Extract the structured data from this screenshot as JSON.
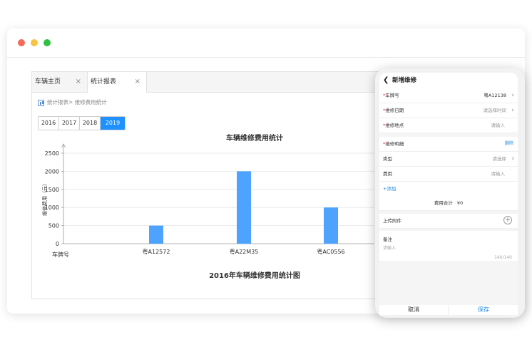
{
  "tabs": [
    {
      "label": "车辆主页",
      "close": "×"
    },
    {
      "label": "统计报表",
      "close": "×"
    }
  ],
  "breadcrumb": {
    "parent": "统计报表>",
    "current": "维修费用统计"
  },
  "year_buttons": [
    "2016",
    "2017",
    "2018",
    "2019"
  ],
  "active_year": "2019",
  "chart_data": {
    "type": "bar",
    "title": "车辆维修费用统计",
    "subtitle": "2016年车辆维修费用统计图",
    "xlabel": "车牌号",
    "ylabel": "维修费用（元）",
    "categories": [
      "粤A12572",
      "粤A22M35",
      "粤AC0556"
    ],
    "values": [
      500,
      2000,
      1000
    ],
    "ylim": [
      0,
      2500
    ],
    "yticks": [
      0,
      500,
      1000,
      1500,
      2000,
      2500
    ],
    "color": "#4da3ff",
    "grid": true
  },
  "mobile": {
    "title": "新增维修",
    "plate_label": "车牌号",
    "plate_value": "粤A12138",
    "date_label": "维修日期",
    "date_placeholder": "请选择时间",
    "place_label": "维修地点",
    "place_placeholder": "请输入",
    "desc_label": "维修明细",
    "delete_label": "删除",
    "type_label": "类型",
    "type_placeholder": "请选择",
    "cost_label": "费用",
    "cost_placeholder": "请输入",
    "add_label": "+添加",
    "total_label": "费用合计",
    "total_value": "¥0",
    "attach_label": "上传附件",
    "memo_label": "备注",
    "memo_placeholder": "请输入",
    "memo_count": "140/140",
    "cancel_label": "取消",
    "save_label": "保存"
  }
}
